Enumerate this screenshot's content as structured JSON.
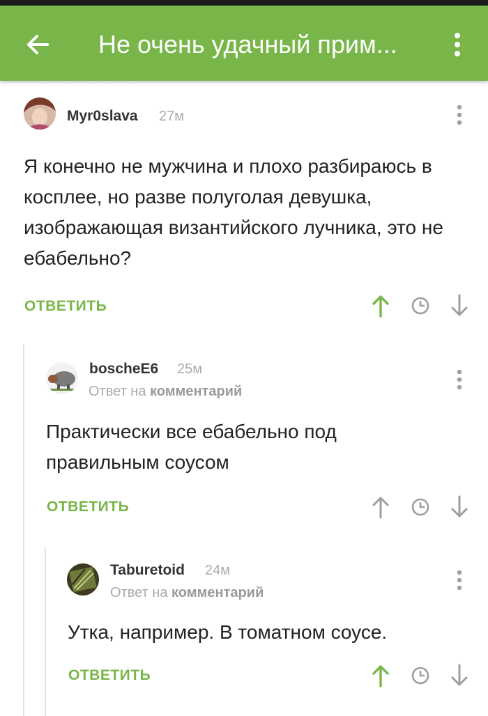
{
  "header": {
    "title": "Не очень удачный прим...",
    "back_icon": "arrow-left-icon",
    "menu_icon": "more-vertical-icon"
  },
  "colors": {
    "accent": "#79b64a",
    "upvoted": "#79b64a",
    "muted": "#aaaaaa"
  },
  "comments": [
    {
      "username": "Myr0slava",
      "time": "27м",
      "reply_to_prefix": "",
      "reply_to_link": "",
      "body": "Я конечно не мужчина и плохо разбираюсь в косплее, но разве полуголая девушка, изображающая византийского лучника, это не ебабельно?",
      "reply_label": "ОТВЕТИТЬ",
      "upvoted": true
    },
    {
      "username": "boscheE6",
      "time": "25м",
      "reply_to_prefix": "Ответ на",
      "reply_to_link": "комментарий",
      "body": "Практически все ебабельно под правильным соусом",
      "reply_label": "ОТВЕТИТЬ",
      "upvoted": false
    },
    {
      "username": "Taburetoid",
      "time": "24м",
      "reply_to_prefix": "Ответ на",
      "reply_to_link": "комментарий",
      "body": "Утка, например. В томатном соусе.",
      "reply_label": "ОТВЕТИТЬ",
      "upvoted": true
    }
  ]
}
